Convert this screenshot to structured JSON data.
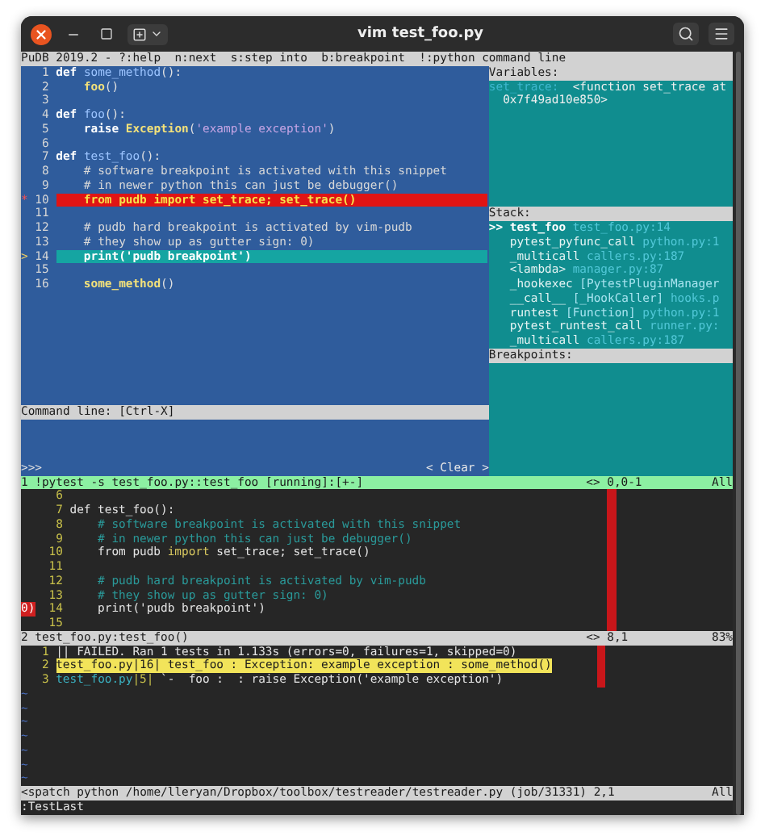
{
  "window": {
    "title": "vim test_foo.py"
  },
  "pudb": {
    "header": "PuDB 2019.2 - ?:help  n:next  s:step into  b:breakpoint  !:python command line",
    "source": [
      {
        "number": "1",
        "kind": "normal",
        "tokens": [
          {
            "text": "def ",
            "kind": "keyword"
          },
          {
            "text": "some_method",
            "kind": "name"
          },
          {
            "text": "():",
            "kind": "punct"
          }
        ]
      },
      {
        "number": "2",
        "kind": "normal",
        "tokens": [
          {
            "text": "    foo",
            "kind": "call"
          },
          {
            "text": "()",
            "kind": "punct"
          }
        ]
      },
      {
        "number": "3",
        "kind": "normal"
      },
      {
        "number": "4",
        "kind": "normal",
        "tokens": [
          {
            "text": "def ",
            "kind": "keyword"
          },
          {
            "text": "foo",
            "kind": "name"
          },
          {
            "text": "():",
            "kind": "punct"
          }
        ]
      },
      {
        "number": "5",
        "kind": "normal",
        "tokens": [
          {
            "text": "    raise ",
            "kind": "keyword"
          },
          {
            "text": "Exception",
            "kind": "call"
          },
          {
            "text": "(",
            "kind": "punct"
          },
          {
            "text": "'example exception'",
            "kind": "string"
          },
          {
            "text": ")",
            "kind": "punct"
          }
        ]
      },
      {
        "number": "6",
        "kind": "normal"
      },
      {
        "number": "7",
        "kind": "normal",
        "tokens": [
          {
            "text": "def ",
            "kind": "keyword"
          },
          {
            "text": "test_foo",
            "kind": "name"
          },
          {
            "text": "():",
            "kind": "punct"
          }
        ]
      },
      {
        "number": "8",
        "kind": "normal",
        "tokens": [
          {
            "text": "    # software breakpoint is activated with this snippet",
            "kind": "comment"
          }
        ]
      },
      {
        "number": "9",
        "kind": "normal",
        "tokens": [
          {
            "text": "    # in newer python this can just be debugger()",
            "kind": "comment"
          }
        ]
      },
      {
        "number": "10",
        "kind": "breakpoint",
        "marker": "*",
        "tokens": [
          {
            "text": "    from pudb import set_trace; set_trace()",
            "kind": "plain"
          }
        ]
      },
      {
        "number": "11",
        "kind": "normal"
      },
      {
        "number": "12",
        "kind": "normal",
        "tokens": [
          {
            "text": "    # pudb hard breakpoint is activated by vim-pudb",
            "kind": "comment"
          }
        ]
      },
      {
        "number": "13",
        "kind": "normal",
        "tokens": [
          {
            "text": "    # they show up as gutter sign: 0)",
            "kind": "comment"
          }
        ]
      },
      {
        "number": "14",
        "kind": "current",
        "marker": ">",
        "tokens": [
          {
            "text": "    print('pudb breakpoint')",
            "kind": "plain"
          }
        ]
      },
      {
        "number": "15",
        "kind": "normal"
      },
      {
        "number": "16",
        "kind": "normal",
        "tokens": [
          {
            "text": "    some_method",
            "kind": "call"
          },
          {
            "text": "()",
            "kind": "punct"
          }
        ]
      }
    ],
    "command": {
      "label": "Command line: [Ctrl-X]",
      "prompt": ">>>",
      "clear": "< Clear >"
    },
    "variables": {
      "title": "Variables:",
      "items": [
        {
          "name": "set_trace:",
          "value": "<function set_trace at",
          "continuation": "0x7f49ad10e850>"
        }
      ]
    },
    "stack": {
      "title": "Stack:",
      "frames": [
        {
          "marker": ">>",
          "function": "test_foo",
          "location": "test_foo.py:14",
          "selected": true
        },
        {
          "function": "pytest_pyfunc_call",
          "location": "python.py:1",
          "selected": false
        },
        {
          "function": "_multicall",
          "location": "callers.py:187",
          "selected": false
        },
        {
          "function": "<lambda>",
          "location": "manager.py:87",
          "selected": false
        },
        {
          "function": "_hookexec",
          "detail": "[PytestPluginManager",
          "selected": false
        },
        {
          "function": "__call__",
          "detail": "[_HookCaller]",
          "location": "hooks.p",
          "selected": false
        },
        {
          "function": "runtest",
          "detail": "[Function]",
          "location": "python.py:1",
          "selected": false
        },
        {
          "function": "pytest_runtest_call",
          "location": "runner.py:",
          "selected": false
        },
        {
          "function": "_multicall",
          "location": "callers.py:187",
          "selected": false
        }
      ]
    },
    "breakpoints": {
      "title": "Breakpoints:"
    }
  },
  "vim": {
    "top_status": {
      "text": "1 !pytest -s test_foo.py::test_foo [running]:[+-]",
      "position": "<> 0,0-1",
      "scroll": "All"
    },
    "lines": [
      {
        "number": "6"
      },
      {
        "number": "7",
        "tokens": [
          {
            "text": "def test_foo():",
            "kind": "plain"
          }
        ]
      },
      {
        "number": "8",
        "tokens": [
          {
            "text": "    # software breakpoint is activated with this snippet",
            "kind": "comment"
          }
        ]
      },
      {
        "number": "9",
        "tokens": [
          {
            "text": "    # in newer python this can just be debugger()",
            "kind": "comment"
          }
        ]
      },
      {
        "number": "10",
        "tokens": [
          {
            "text": "    from pudb ",
            "kind": "plain"
          },
          {
            "text": "import",
            "kind": "keyword"
          },
          {
            "text": " set_trace; set_trace()",
            "kind": "plain"
          }
        ]
      },
      {
        "number": "11"
      },
      {
        "number": "12",
        "tokens": [
          {
            "text": "    # pudb hard breakpoint is activated by vim-pudb",
            "kind": "comment"
          }
        ]
      },
      {
        "number": "13",
        "tokens": [
          {
            "text": "    # they show up as gutter sign: 0)",
            "kind": "comment"
          }
        ]
      },
      {
        "number": "14",
        "sign": "0)",
        "tokens": [
          {
            "text": "    print('pudb breakpoint')",
            "kind": "plain"
          }
        ]
      },
      {
        "number": "15"
      }
    ],
    "bottom_status": {
      "text": "2 test_foo.py:test_foo()",
      "position": "<> 8,1",
      "scroll": "83%"
    },
    "quickfix": [
      {
        "number": "1",
        "selected": false,
        "tokens": [
          {
            "text": "|| FAILED. Ran 1 tests in 1.133s (errors=0, failures=1, skipped=0)",
            "kind": "plain"
          }
        ]
      },
      {
        "number": "2",
        "selected": true,
        "tokens": [
          {
            "text": "test_foo.py",
            "kind": "file"
          },
          {
            "text": "|16|",
            "kind": "position"
          },
          {
            "text": " test_foo : Exception: example exception : some_method()",
            "kind": "plain"
          }
        ]
      },
      {
        "number": "3",
        "selected": false,
        "tokens": [
          {
            "text": "test_foo.py",
            "kind": "file"
          },
          {
            "text": "|5|",
            "kind": "position"
          },
          {
            "text": " `-  foo :  : raise Exception('example exception')",
            "kind": "plain"
          }
        ]
      }
    ],
    "filler": [
      "~",
      "~",
      "~",
      "~",
      "~",
      "~",
      "~"
    ],
    "file_status": {
      "text": "<spatch python /home/lleryan/Dropbox/toolbox/testreader/testreader.py (job/31331) 2,1",
      "scroll": "All"
    },
    "command": ":TestLast"
  }
}
